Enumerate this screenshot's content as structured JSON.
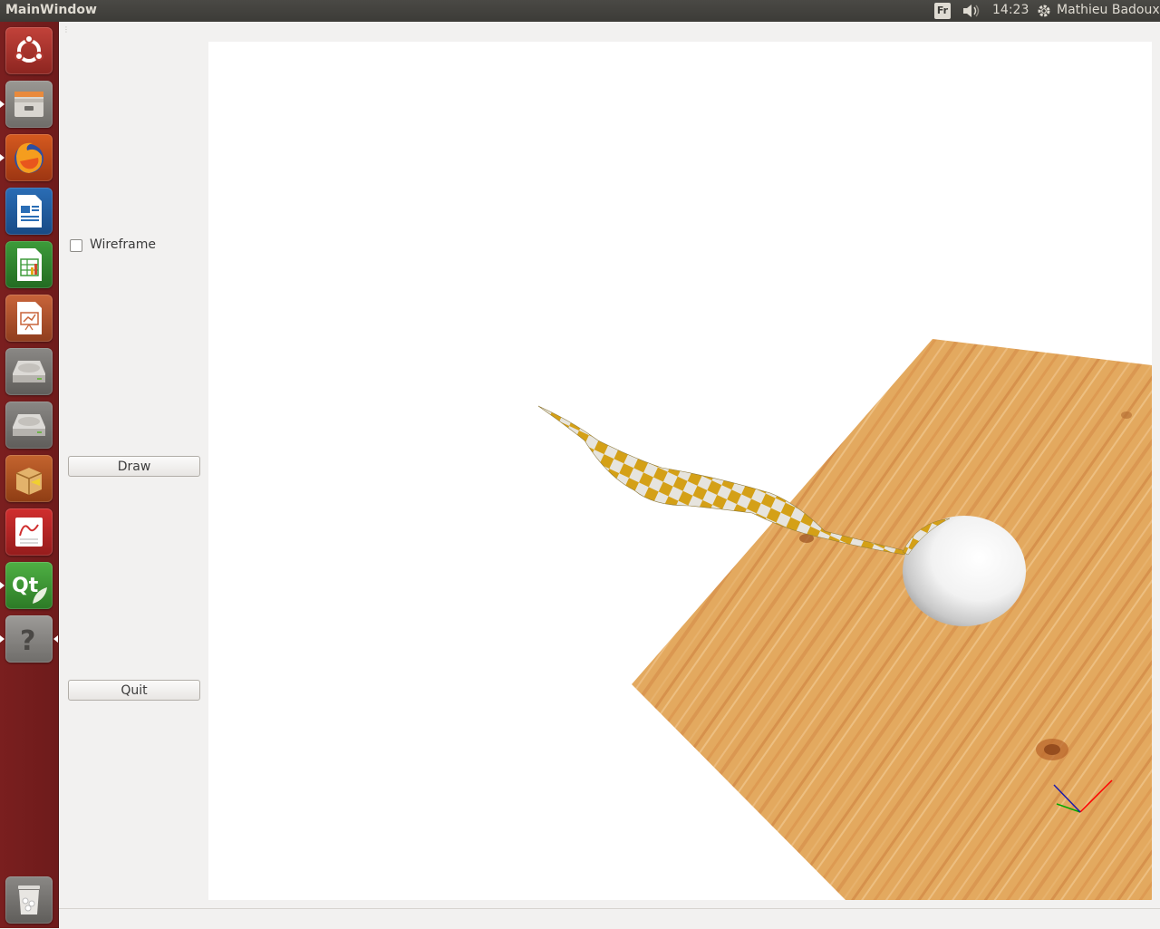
{
  "top_panel": {
    "window_title": "MainWindow",
    "keyboard_layout": "Fr",
    "clock": "14:23",
    "user": "Mathieu Badoux"
  },
  "launcher": {
    "items": [
      {
        "name": "ubuntu-dash-icon"
      },
      {
        "name": "files-icon"
      },
      {
        "name": "firefox-icon"
      },
      {
        "name": "libreoffice-writer-icon"
      },
      {
        "name": "libreoffice-calc-icon"
      },
      {
        "name": "libreoffice-impress-icon"
      },
      {
        "name": "drive-icon"
      },
      {
        "name": "drive-icon"
      },
      {
        "name": "software-center-icon"
      },
      {
        "name": "document-viewer-icon"
      },
      {
        "name": "qt-creator-icon"
      },
      {
        "name": "unknown-app-icon"
      },
      {
        "name": "trash-icon"
      }
    ]
  },
  "controls": {
    "wireframe_label": "Wireframe",
    "wireframe_checked": false,
    "draw_label": "Draw",
    "quit_label": "Quit"
  },
  "colors": {
    "launcher_bg": "#7a1f1f",
    "panel_bg": "#3c3b37",
    "wood": "#e0a85e",
    "cloth_checker": "#d4a017",
    "axis_x": "#ff0000",
    "axis_y": "#00aa00",
    "axis_z": "#0000cc"
  }
}
